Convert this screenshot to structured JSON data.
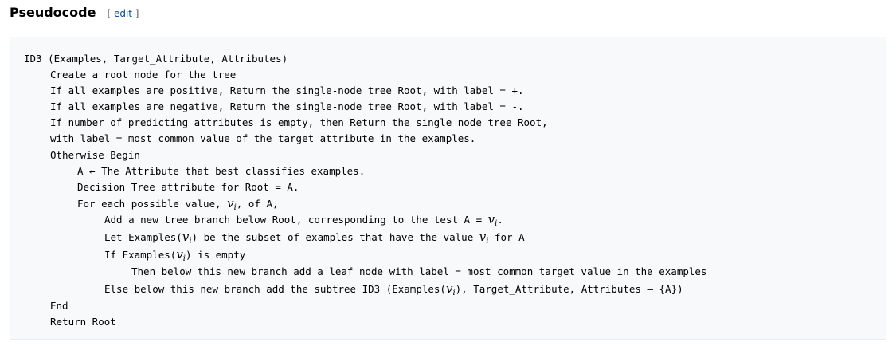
{
  "section": {
    "title": "Pseudocode",
    "edit_open": "[ ",
    "edit_label": "edit",
    "edit_close": " ]"
  },
  "code": {
    "l1": "ID3 (Examples, Target_Attribute, Attributes)",
    "l2": "Create a root node for the tree",
    "l3": "If all examples are positive, Return the single-node tree Root, with label = +.",
    "l4": "If all examples are negative, Return the single-node tree Root, with label = -.",
    "l5": "If number of predicting attributes is empty, then Return the single node tree Root,",
    "l6": "with label = most common value of the target attribute in the examples.",
    "l7": "Otherwise Begin",
    "l8": "A ← The Attribute that best classifies examples.",
    "l9": "Decision Tree attribute for Root = A.",
    "l10_a": "For each possible value, ",
    "l10_b": ", of A,",
    "l11_a": "Add a new tree branch below Root, corresponding to the test A = ",
    "l11_b": ".",
    "l12_a": "Let Examples(",
    "l12_b": ") be the subset of examples that have the value ",
    "l12_c": " for A",
    "l13_a": "If Examples(",
    "l13_b": ") is empty",
    "l14": "Then below this new branch add a leaf node with label = most common target value in the examples",
    "l15_a": "Else below this new branch add the subtree ID3 (Examples(",
    "l15_b": "), Target_Attribute, Attributes – {A})",
    "l16": "End",
    "l17": "Return Root",
    "var": "v",
    "var_sub": "i"
  }
}
